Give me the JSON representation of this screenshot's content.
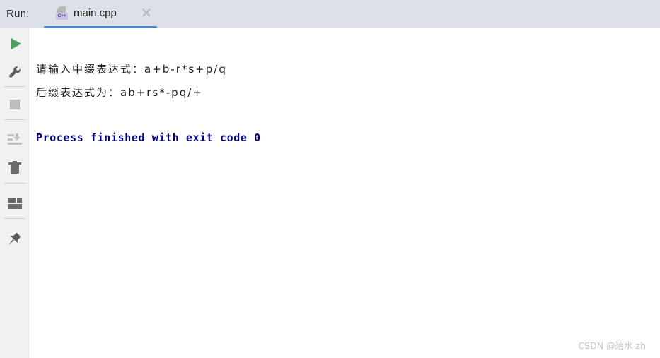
{
  "window": {
    "run_label": "Run:",
    "header_bg": "#dfe1e9",
    "console_bg": "#ffffff"
  },
  "tab": {
    "title": "main.cpp",
    "file_type_badge": "C++",
    "active_underline_color": "#4a86c8",
    "close_label": "×"
  },
  "toolbar": {
    "items": [
      {
        "name": "rerun-button",
        "tooltip": "Rerun"
      },
      {
        "name": "edit-configurations-button",
        "tooltip": "Edit Configurations"
      },
      {
        "name": "stop-button",
        "tooltip": "Stop"
      },
      {
        "name": "scroll-to-end-button",
        "tooltip": "Scroll to End"
      },
      {
        "name": "clear-all-button",
        "tooltip": "Clear All"
      },
      {
        "name": "layout-settings-button",
        "tooltip": "Layout Settings"
      },
      {
        "name": "pin-tab-button",
        "tooltip": "Pin Tab"
      }
    ],
    "play_color": "#4f9e63",
    "icon_color": "#6b6b6b",
    "disabled_color": "#c2c2c2"
  },
  "console": {
    "lines": [
      {
        "text": "请输入中缀表达式：a+b-r*s+p/q",
        "color": "#231f20"
      },
      {
        "text": "后缀表达式为：ab+rs*-pq/+",
        "color": "#231f20"
      },
      {
        "text": "",
        "color": "#231f20"
      },
      {
        "text": "Process finished with exit code 0",
        "color": "#000080"
      }
    ],
    "prompt_line": "请输入中缀表达式：a+b-r*s+p/q",
    "result_line": "后缀表达式为：ab+rs*-pq/+",
    "exit_line": "Process finished with exit code 0",
    "exit_code": "0"
  },
  "watermark": {
    "text": "CSDN @落水 zh"
  }
}
